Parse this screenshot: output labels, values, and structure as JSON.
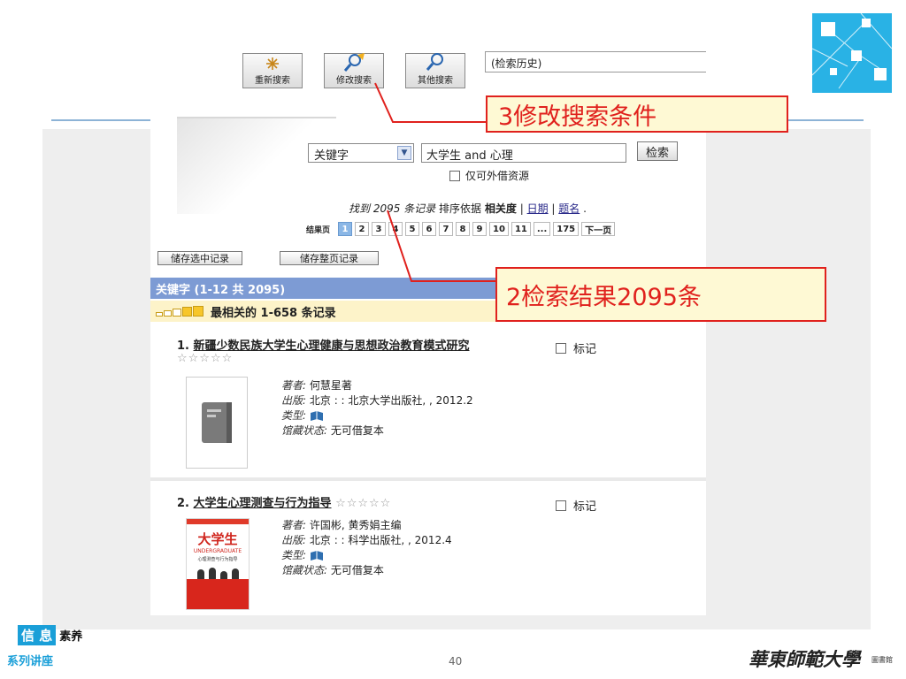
{
  "toolbar": {
    "buttons": [
      {
        "label": "重新搜索",
        "icon": "asterisk-icon"
      },
      {
        "label": "修改搜索",
        "icon": "edit-search-icon"
      },
      {
        "label": "其他搜索",
        "icon": "magnifier-icon"
      }
    ],
    "history_label": "(检索历史)"
  },
  "search": {
    "field_value": "关键字",
    "query_value": "大学生 and 心理",
    "button_label": "检索",
    "only_loanable_label": "仅可外借资源"
  },
  "results": {
    "found_text": "找到 2095 条记录",
    "sort_label": "排序依据",
    "sort_current": "相关度",
    "sep1": "|",
    "sort_date": "日期",
    "sep2": "|",
    "sort_title": "题名",
    "trailing": ".",
    "pages_label": "结果页",
    "pages": [
      "1",
      "2",
      "3",
      "4",
      "5",
      "6",
      "7",
      "8",
      "9",
      "10",
      "11",
      "...",
      "175",
      "下一页"
    ],
    "current_page": "1",
    "save_selected": "储存选中记录",
    "save_page": "储存整页记录",
    "header": "关键字 (1-12 共 2095)",
    "relevance_label": "最相关的 1-658 条记录"
  },
  "records": [
    {
      "number": "1.",
      "title": "新疆少数民族大学生心理健康与思想政治教育模式研究",
      "stars": "☆☆☆☆☆",
      "mark_label": "标记",
      "author_key": "著者:",
      "author": "何慧星著",
      "publisher_key": "出版:",
      "publisher": "北京 : : 北京大学出版社, , 2012.2",
      "type_key": "类型:",
      "status_key": "馆藏状态:",
      "status": "无可借复本"
    },
    {
      "number": "2.",
      "title": "大学生心理测查与行为指导",
      "stars": "☆☆☆☆☆",
      "mark_label": "标记",
      "author_key": "著者:",
      "author": "许国彬, 黄秀娟主编",
      "publisher_key": "出版:",
      "publisher": "北京 : : 科学出版社, , 2012.4",
      "type_key": "类型:",
      "status_key": "馆藏状态:",
      "status": "无可借复本",
      "cover_title": "大学生",
      "cover_subtitle": "UNDERGRADUATE",
      "cover_line": "心理测查与行为指导"
    }
  ],
  "callouts": {
    "modify": "3修改搜索条件",
    "count": "2检索结果2095条"
  },
  "footer": {
    "badge": "信 息",
    "badge_suffix": "素养",
    "series": "系列讲座",
    "page_number": "40",
    "university": "華東師範大學",
    "library": "圖書館"
  },
  "colors": {
    "accent_blue": "#1a9fd8",
    "callout_red": "#e0211d",
    "callout_fill": "#fef9d4",
    "result_header": "#7d9bd4"
  }
}
